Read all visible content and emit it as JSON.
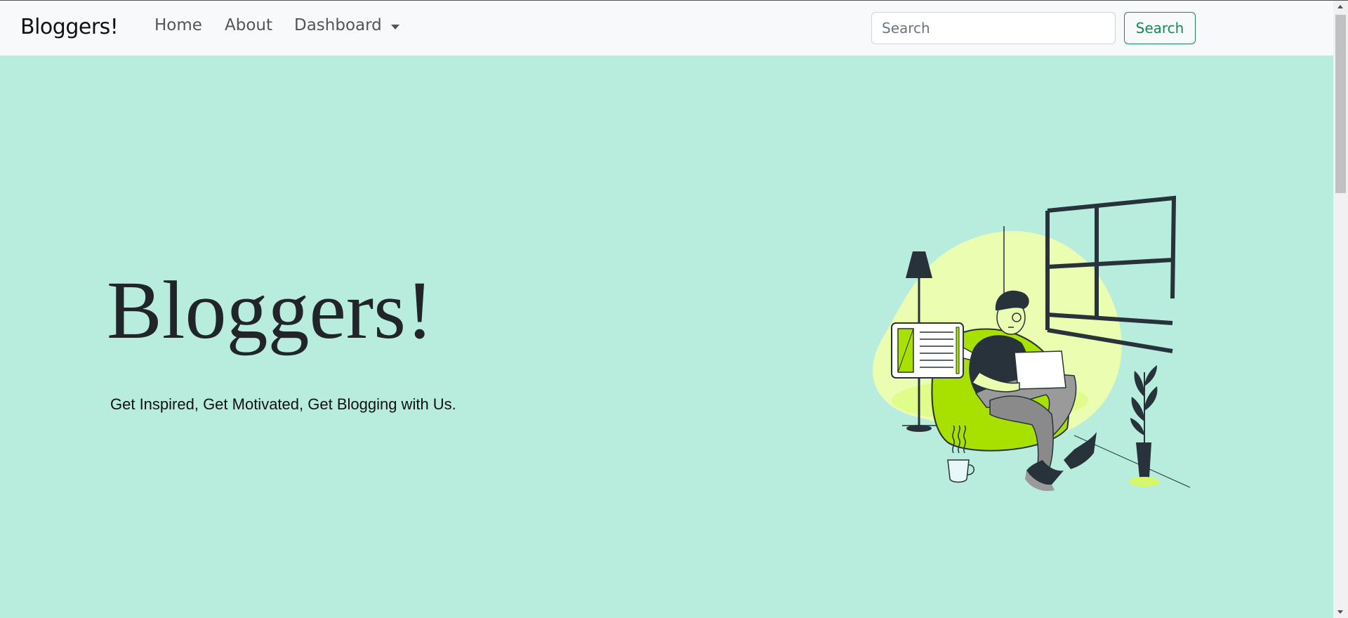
{
  "navbar": {
    "brand": "Bloggers!",
    "links": [
      "Home",
      "About",
      "Dashboard"
    ],
    "search": {
      "placeholder": "Search",
      "value": "",
      "button_label": "Search"
    }
  },
  "hero": {
    "title": "Bloggers!",
    "subtitle": "Get Inspired, Get Motivated, Get Blogging with Us."
  },
  "icons": [
    "dropdown-caret-icon",
    "scroll-up-arrow-icon",
    "scroll-down-arrow-icon"
  ],
  "colors": {
    "page_bg": "#b8eddd",
    "navbar_bg": "#f8f9fa",
    "accent_green": "#198754",
    "illustration_lime": "#a8e000"
  }
}
